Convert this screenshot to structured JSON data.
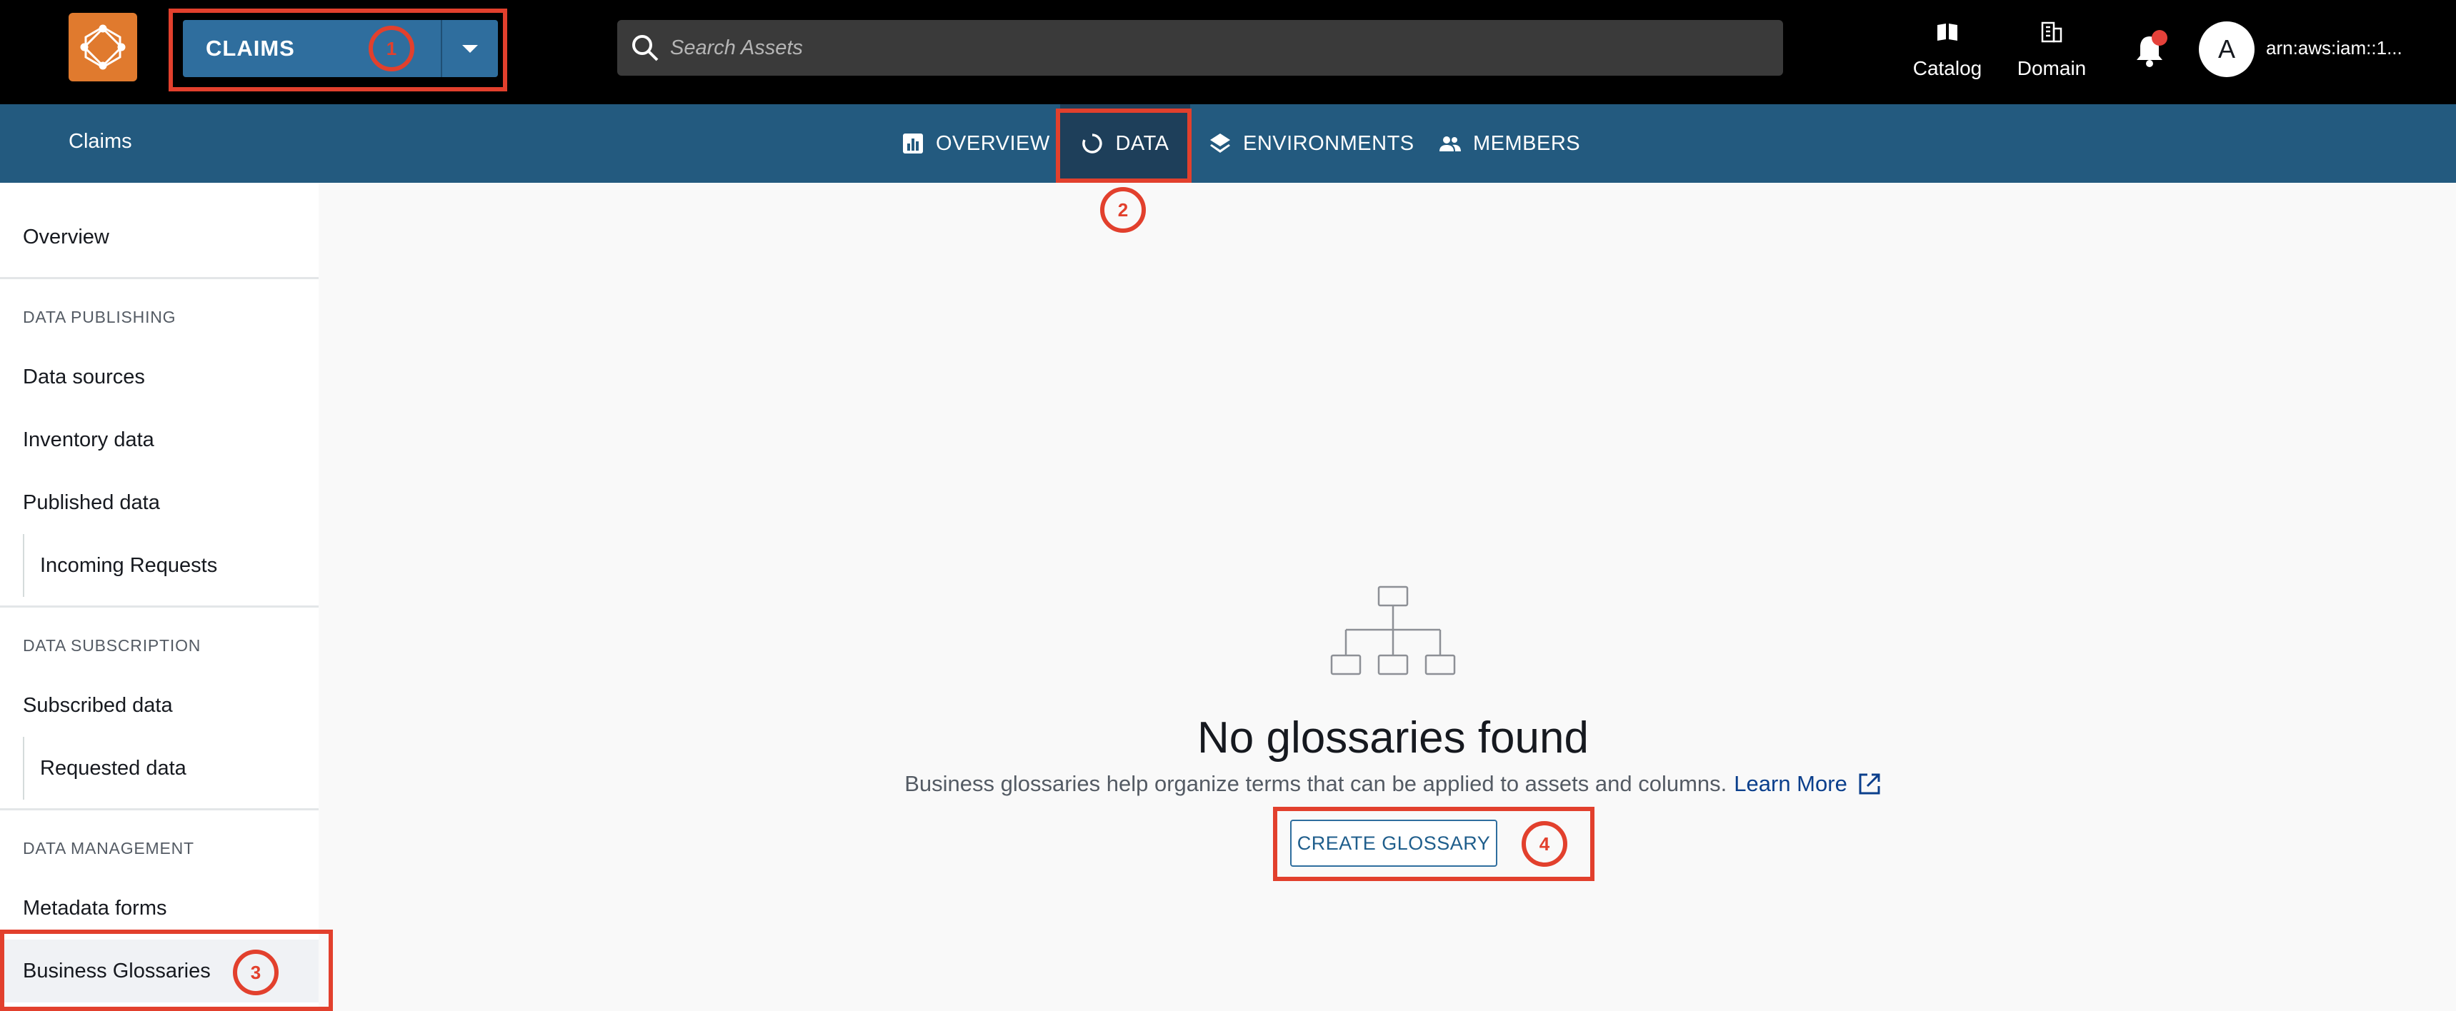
{
  "header": {
    "project_selector": {
      "label": "CLAIMS"
    },
    "search": {
      "placeholder": "Search Assets"
    },
    "nav": [
      {
        "label": "Catalog",
        "icon": "catalog-book-icon"
      },
      {
        "label": "Domain",
        "icon": "building-icon"
      }
    ],
    "notifications": {
      "icon": "bell-icon",
      "has_unread": true
    },
    "user": {
      "avatar_letter": "A",
      "name": "arn:aws:iam::1..."
    }
  },
  "subnav": {
    "title": "Claims",
    "tabs": [
      {
        "label": "OVERVIEW",
        "icon": "bar-chart-icon"
      },
      {
        "label": "DATA",
        "icon": "refresh-circle-icon",
        "active": true
      },
      {
        "label": "ENVIRONMENTS",
        "icon": "layers-icon"
      },
      {
        "label": "MEMBERS",
        "icon": "people-icon"
      }
    ]
  },
  "sidebar": {
    "overview": "Overview",
    "sections": [
      {
        "heading": "DATA PUBLISHING",
        "items": [
          "Data sources",
          "Inventory data",
          "Published data"
        ],
        "sub_items": [
          "Incoming Requests"
        ]
      },
      {
        "heading": "DATA SUBSCRIPTION",
        "items": [
          "Subscribed data"
        ],
        "sub_items": [
          "Requested data"
        ]
      },
      {
        "heading": "DATA MANAGEMENT",
        "items": [
          "Metadata forms",
          "Business Glossaries"
        ]
      }
    ],
    "active_item": "Business Glossaries"
  },
  "main": {
    "empty_state": {
      "icon": "hierarchy-icon",
      "title": "No glossaries found",
      "description": "Business glossaries help organize terms that can be applied to assets and columns.",
      "learn_more": "Learn More",
      "action_button": "CREATE GLOSSARY"
    }
  },
  "callouts": [
    "1",
    "2",
    "3",
    "4"
  ],
  "colors": {
    "topbar": "#000000",
    "subnav": "#235a7f",
    "active_tab": "#1e3f5a",
    "project_button": "#2f6e9e",
    "logo": "#e07a2e",
    "callout": "#e2402d",
    "link": "#0b3f8c"
  }
}
